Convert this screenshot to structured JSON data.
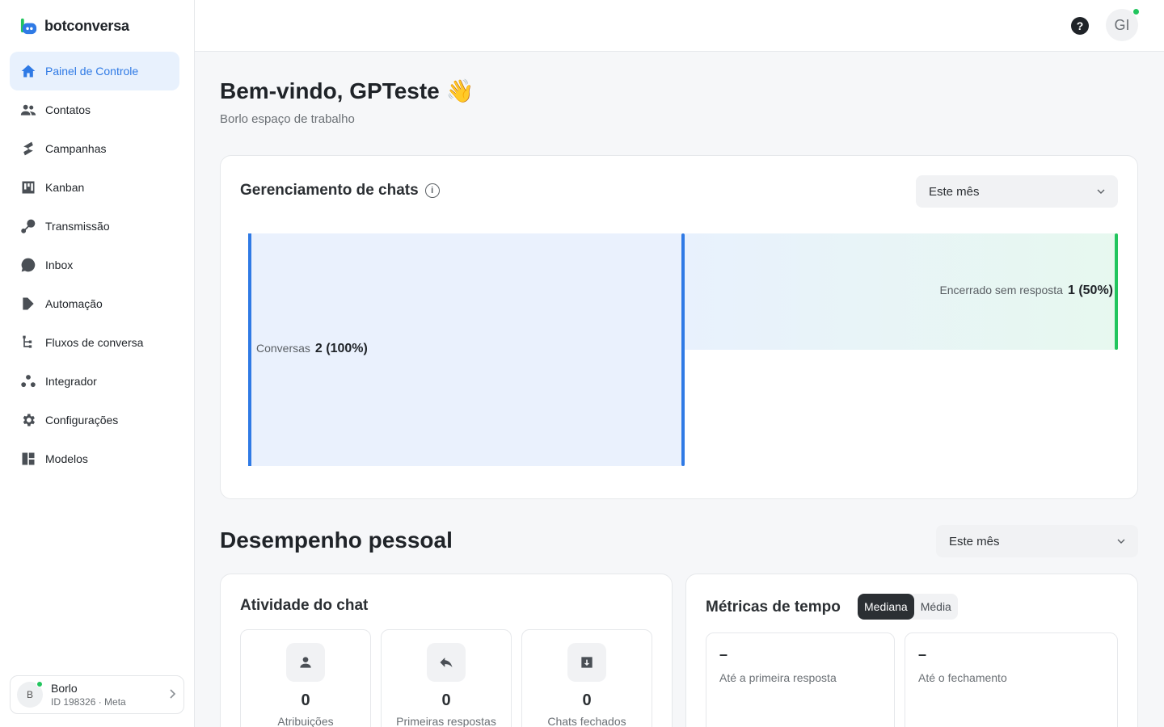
{
  "app": {
    "name": "botconversa"
  },
  "sidebar": {
    "items": [
      {
        "label": "Painel de Controle"
      },
      {
        "label": "Contatos"
      },
      {
        "label": "Campanhas"
      },
      {
        "label": "Kanban"
      },
      {
        "label": "Transmissão"
      },
      {
        "label": "Inbox"
      },
      {
        "label": "Automação"
      },
      {
        "label": "Fluxos de conversa"
      },
      {
        "label": "Integrador"
      },
      {
        "label": "Configurações"
      },
      {
        "label": "Modelos"
      }
    ],
    "workspace": {
      "initial": "B",
      "name": "Borlo",
      "id_text": "ID 198326 · Meta"
    }
  },
  "header": {
    "help": "?",
    "user_initials": "GI"
  },
  "main": {
    "welcome": "Bem-vindo, GPTeste 👋",
    "subtitle": "Borlo espaço de trabalho",
    "chats": {
      "title": "Gerenciamento de chats",
      "period": "Este mês",
      "funnel": {
        "conversations_label": "Conversas",
        "conversations_value": "2 (100%)",
        "closed_label": "Encerrado sem resposta",
        "closed_value": "1 (50%)"
      }
    },
    "performance": {
      "title": "Desempenho pessoal",
      "period": "Este mês",
      "activity": {
        "title": "Atividade do chat",
        "stats": [
          {
            "value": "0",
            "label": "Atribuições"
          },
          {
            "value": "0",
            "label": "Primeiras respostas"
          },
          {
            "value": "0",
            "label": "Chats fechados"
          }
        ]
      },
      "metrics": {
        "title": "Métricas de tempo",
        "toggle": [
          "Mediana",
          "Média"
        ],
        "items": [
          {
            "value": "–",
            "label": "Até a primeira resposta"
          },
          {
            "value": "–",
            "label": "Até o fechamento"
          }
        ]
      }
    }
  },
  "colors": {
    "accent": "#2f7ae5",
    "success": "#22c55e"
  }
}
